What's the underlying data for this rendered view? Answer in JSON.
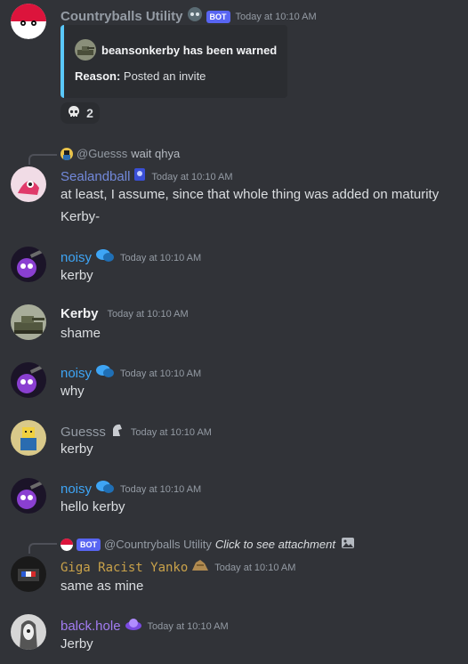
{
  "messages": [
    {
      "username": "Countryballs Utility",
      "color": "#949ba4",
      "bot_tag": "BOT",
      "timestamp": "Today at 10:10 AM",
      "embed": {
        "title": "beansonkerby has been warned",
        "reason_label": "Reason:",
        "reason_text": " Posted an invite",
        "accent": "#5ac8fa"
      },
      "reaction": {
        "icon": "skull-icon",
        "count": "2"
      }
    },
    {
      "reply": {
        "mention": "@Guesss",
        "text": "wait qhya"
      },
      "username": "Sealandball",
      "color": "#7289da",
      "timestamp": "Today at 10:10 AM",
      "lines": [
        "at least, I assume, since that whole thing was added on maturity",
        "Kerby-"
      ]
    },
    {
      "username": "noisy",
      "color": "#3ea5f5",
      "timestamp": "Today at 10:10 AM",
      "text": "kerby"
    },
    {
      "username": "Kerby",
      "color": "#f2f3f5",
      "timestamp": "Today at 10:10 AM",
      "text": "shame"
    },
    {
      "username": "noisy",
      "color": "#3ea5f5",
      "timestamp": "Today at 10:10 AM",
      "text": "why"
    },
    {
      "username": "Guesss",
      "color": "#949ba4",
      "timestamp": "Today at 10:10 AM",
      "text": "kerby"
    },
    {
      "username": "noisy",
      "color": "#3ea5f5",
      "timestamp": "Today at 10:10 AM",
      "text": "hello kerby"
    },
    {
      "reply": {
        "bot_tag": "BOT",
        "mention": "@Countryballs Utility",
        "text": "Click to see attachment"
      },
      "username": "Giga Racist Yanko",
      "color": "#c9a24a",
      "timestamp": "Today at 10:10 AM",
      "text": "same as mine"
    },
    {
      "username": "balck.hole",
      "color": "#a27cf1",
      "timestamp": "Today at 10:10 AM",
      "text": "Jerby"
    }
  ]
}
